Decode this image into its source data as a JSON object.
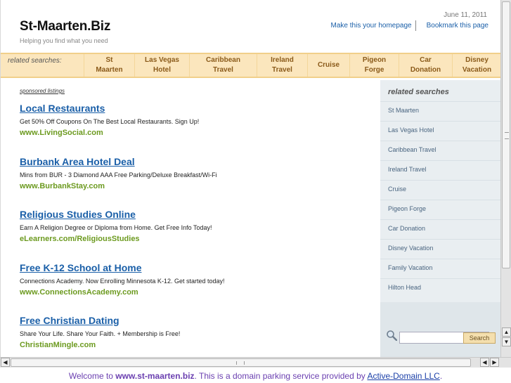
{
  "header": {
    "date": "June 11, 2011",
    "homepage_link": "Make this your homepage",
    "bookmark_link": "Bookmark this page",
    "title": "St-Maarten.Biz",
    "tagline": "Helping you find what you need"
  },
  "related_bar": {
    "label": "related searches:",
    "items": [
      {
        "line1": "St",
        "line2": "Maarten"
      },
      {
        "line1": "Las Vegas",
        "line2": "Hotel"
      },
      {
        "line1": "Caribbean",
        "line2": "Travel"
      },
      {
        "line1": "Ireland",
        "line2": "Travel"
      },
      {
        "line1": "Cruise",
        "line2": ""
      },
      {
        "line1": "Pigeon",
        "line2": "Forge"
      },
      {
        "line1": "Car",
        "line2": "Donation"
      },
      {
        "line1": "Disney",
        "line2": "Vacation"
      }
    ]
  },
  "sponsored_label": "sponsored listings",
  "ads": [
    {
      "title": "Local Restaurants",
      "desc": "Get 50% Off Coupons On The Best Local Restaurants. Sign Up!",
      "url": "www.LivingSocial.com"
    },
    {
      "title": "Burbank Area Hotel Deal",
      "desc": "Mins from BUR - 3 Diamond AAA Free Parking/Deluxe Breakfast/Wi-Fi",
      "url": "www.BurbankStay.com"
    },
    {
      "title": "Religious Studies Online",
      "desc": "Earn A Religion Degree or Diploma from Home. Get Free Info Today!",
      "url": "eLearners.com/ReligiousStudies"
    },
    {
      "title": "Free K-12 School at Home",
      "desc": "Connections Academy. Now Enrolling Minnesota K-12. Get started today!",
      "url": "www.ConnectionsAcademy.com"
    },
    {
      "title": "Free Christian Dating",
      "desc": "Share Your Life. Share Your Faith. + Membership is Free!",
      "url": "ChristianMingle.com"
    }
  ],
  "right_panel": {
    "title": "related searches",
    "items": [
      "St Maarten",
      "Las Vegas Hotel",
      "Caribbean Travel",
      "Ireland Travel",
      "Cruise",
      "Pigeon Forge",
      "Car Donation",
      "Disney Vacation",
      "Family Vacation",
      "Hilton Head"
    ],
    "search_button": "Search",
    "search_value": ""
  },
  "footer": {
    "prefix": "Welcome to ",
    "domain": "www.st-maarten.biz",
    "middle": ". This is a domain parking service provided by ",
    "provider": "Active-Domain LLC",
    "suffix": "."
  }
}
